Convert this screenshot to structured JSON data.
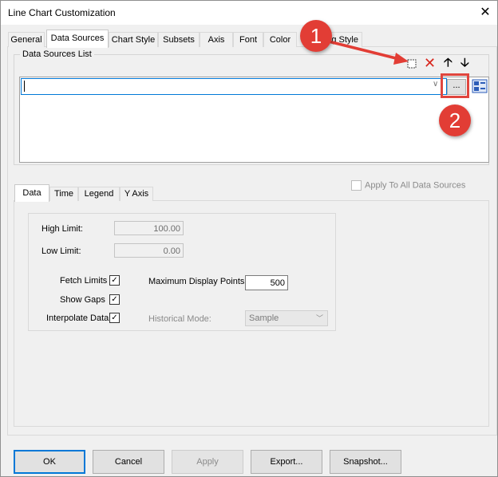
{
  "window": {
    "title": "Line Chart Customization",
    "close_glyph": "✕"
  },
  "tabs": [
    {
      "label": "General"
    },
    {
      "label": "Data Sources",
      "active": true
    },
    {
      "label": "Chart Style"
    },
    {
      "label": "Subsets"
    },
    {
      "label": "Axis"
    },
    {
      "label": "Font"
    },
    {
      "label": "Color"
    },
    {
      "label": "g Style"
    }
  ],
  "data_sources": {
    "group_label": "Data Sources List",
    "combo_value": "",
    "browse_label": "...",
    "icons": [
      "new-item-icon",
      "delete-icon",
      "move-up-icon",
      "move-down-icon",
      "tag-browser-icon"
    ]
  },
  "callouts": {
    "one": "1",
    "two": "2"
  },
  "inner_tabs": [
    {
      "label": "Data",
      "active": true
    },
    {
      "label": "Time"
    },
    {
      "label": "Legend"
    },
    {
      "label": "Y Axis"
    }
  ],
  "apply_all": {
    "label": "Apply To All Data Sources",
    "checked": false,
    "disabled": true
  },
  "data": {
    "high_limit_label": "High Limit:",
    "high_limit_value": "100.00",
    "low_limit_label": "Low Limit:",
    "low_limit_value": "0.00",
    "fetch_limits_label": "Fetch Limits",
    "show_gaps_label": "Show Gaps",
    "interpolate_label": "Interpolate Data",
    "check_mark": "✓",
    "max_points_label": "Maximum Display Points:",
    "max_points_value": "500",
    "historical_mode_label": "Historical Mode:",
    "historical_mode_value": "Sample"
  },
  "buttons": {
    "ok": "OK",
    "cancel": "Cancel",
    "apply": "Apply",
    "export": "Export...",
    "snapshot": "Snapshot..."
  },
  "colors": {
    "accent": "#0078d7",
    "callout": "#e23d35",
    "delete": "#d8271e"
  }
}
